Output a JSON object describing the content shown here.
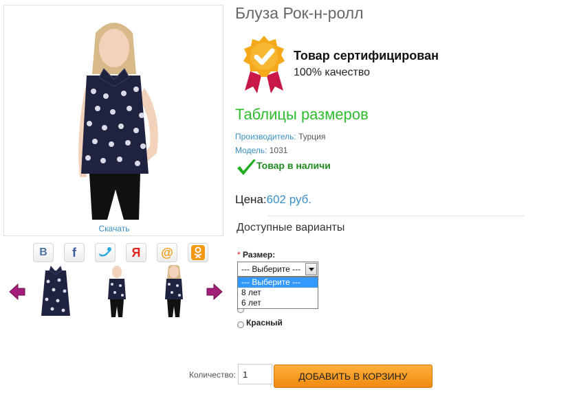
{
  "product": {
    "title": "Блуза Рок-н-ролл",
    "download_label": "Скачать"
  },
  "certificate": {
    "title": "Товар сертифицирован",
    "subtitle": "100% качество"
  },
  "size_table_link": "Таблицы размеров",
  "meta": {
    "manufacturer_key": "Производитель:",
    "manufacturer_value": "Турция",
    "model_key": "Модель:",
    "model_value": "1031"
  },
  "stock_status": "Товар в наличи",
  "price": {
    "label": "Цена:",
    "value": "602 руб."
  },
  "options": {
    "title": "Доступные варианты",
    "size_required_mark": "*",
    "size_label": "Размер:",
    "size_select_value": "--- Выберите ---",
    "size_dropdown_items": [
      "--- Выберите ---",
      "8 лет",
      "6 лет"
    ],
    "color_radios": [
      "Красный"
    ]
  },
  "quantity": {
    "label": "Количество:",
    "value": "1"
  },
  "cart_button_label": "ДОБАВИТЬ В КОРЗИНУ",
  "social_icons": [
    "vk-icon",
    "facebook-icon",
    "twitter-icon",
    "myworld-icon",
    "mail-icon",
    "odnoklassniki-icon"
  ],
  "social_labels": [
    "В",
    "f",
    "",
    "Я",
    "@",
    ""
  ],
  "colors": {
    "accent_blue": "#3a8fc7",
    "link_green": "#2dbd2d",
    "stock_green": "#1f8a1f",
    "cart_orange": "#f08a10",
    "nav_arrow": "#a31e78"
  }
}
